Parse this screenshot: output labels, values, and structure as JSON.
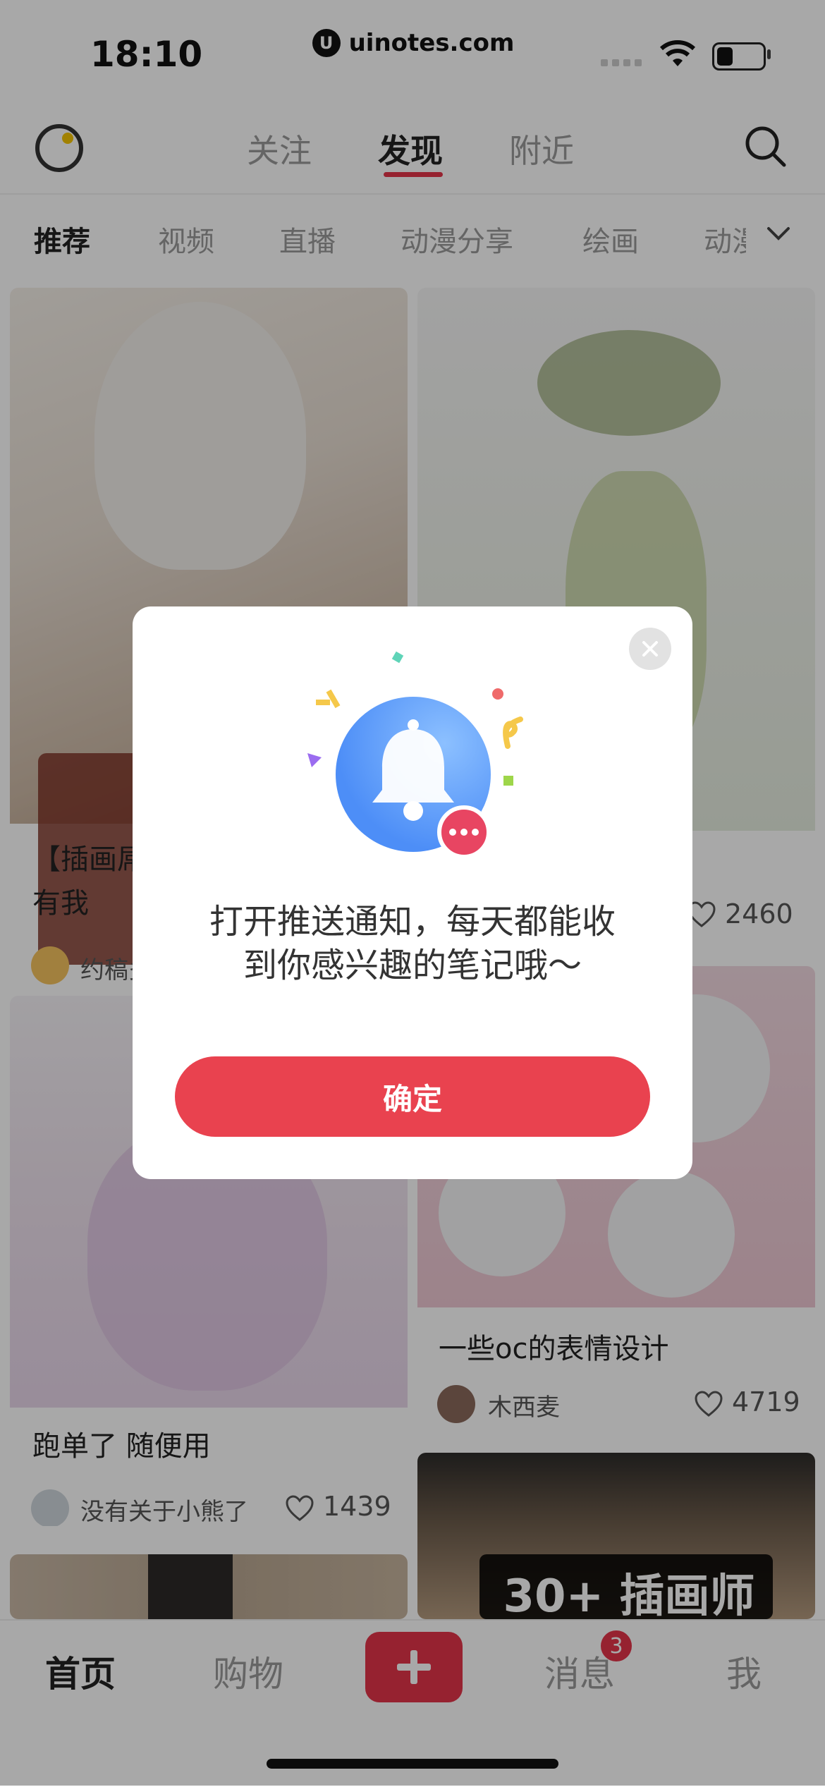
{
  "status_bar": {
    "time": "18:10",
    "url": "uinotes.com"
  },
  "header": {
    "tabs": [
      "关注",
      "发现",
      "附近"
    ],
    "active_tab": "发现"
  },
  "categories": [
    "推荐",
    "视频",
    "直播",
    "动漫分享",
    "绘画",
    "动漫"
  ],
  "feed": {
    "card1": {
      "title": "【插画屌\n有我",
      "author": "约稿多",
      "likes": ""
    },
    "card2": {
      "likes": "2460"
    },
    "card3": {
      "title": "跑单了 随便用",
      "author": "没有关于小熊了",
      "likes": "1439"
    },
    "card4": {
      "title": "一些oc的表情设计",
      "author": "木西麦",
      "likes": "4719"
    },
    "card5": {
      "overlay_text": "30+ 插画师"
    }
  },
  "tabbar": {
    "home": "首页",
    "shop": "购物",
    "add": "+",
    "messages": "消息",
    "messages_badge": "3",
    "me": "我"
  },
  "dialog": {
    "text_line1": "打开推送通知，每天都能收",
    "text_line2": "到你感兴趣的笔记哦～",
    "confirm": "确定",
    "colors": {
      "accent": "#e9424f",
      "bell": "#4d8ef7"
    }
  }
}
